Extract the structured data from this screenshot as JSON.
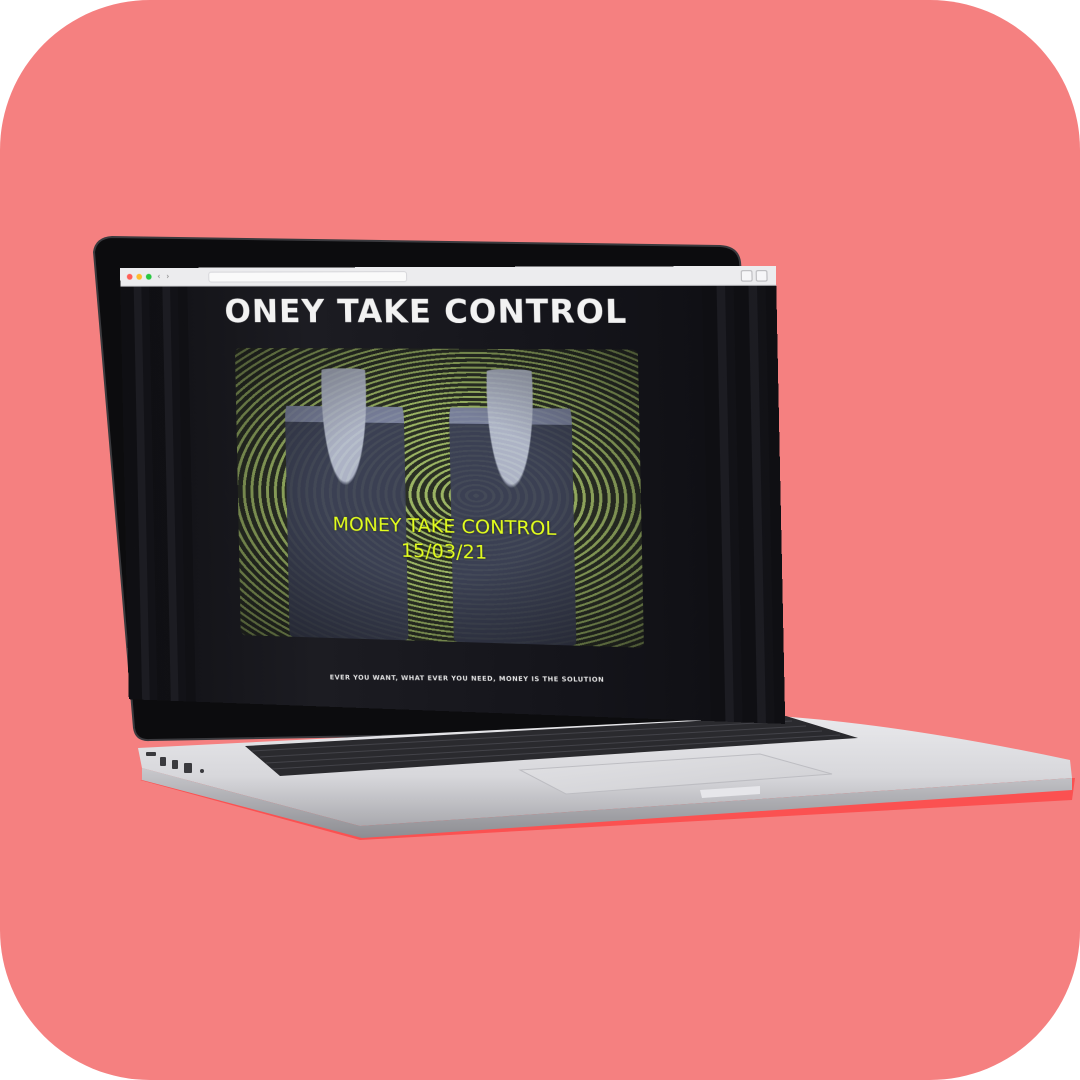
{
  "colors": {
    "background": "#f58080",
    "overlay_text": "#e4ff1e",
    "print_green": "#9bb463"
  },
  "browser": {
    "back_icon": "chevron-left-icon",
    "forward_icon": "chevron-right-icon",
    "share_icon": "share-icon",
    "tabs_icon": "tabs-icon"
  },
  "page": {
    "shirt_text": "ONEY TAKE CONTROL",
    "overlay_title": "MONEY TAKE CONTROL",
    "overlay_date": "15/03/21",
    "tagline": "EVER YOU WANT, WHAT EVER YOU NEED, MONEY IS THE SOLUTION"
  }
}
